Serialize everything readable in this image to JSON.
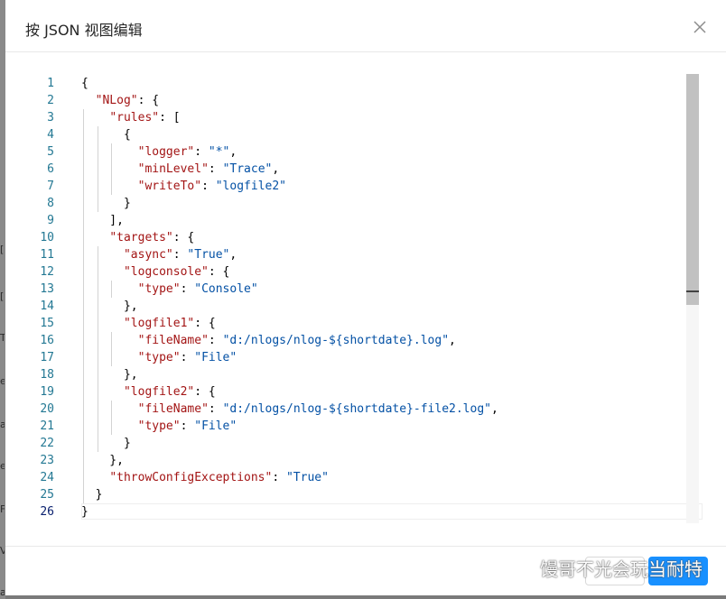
{
  "dialog": {
    "title": "按 JSON 视图编辑",
    "close_icon": "close-icon"
  },
  "editor": {
    "current_line": 26,
    "lines": [
      [
        {
          "t": "p",
          "v": "{"
        }
      ],
      [
        {
          "t": "p",
          "v": "  "
        },
        {
          "t": "k",
          "v": "\"NLog\""
        },
        {
          "t": "p",
          "v": ": {"
        }
      ],
      [
        {
          "t": "p",
          "v": "    "
        },
        {
          "t": "k",
          "v": "\"rules\""
        },
        {
          "t": "p",
          "v": ": ["
        }
      ],
      [
        {
          "t": "p",
          "v": "      {"
        }
      ],
      [
        {
          "t": "p",
          "v": "        "
        },
        {
          "t": "k",
          "v": "\"logger\""
        },
        {
          "t": "p",
          "v": ": "
        },
        {
          "t": "s",
          "v": "\"*\""
        },
        {
          "t": "p",
          "v": ","
        }
      ],
      [
        {
          "t": "p",
          "v": "        "
        },
        {
          "t": "k",
          "v": "\"minLevel\""
        },
        {
          "t": "p",
          "v": ": "
        },
        {
          "t": "s",
          "v": "\"Trace\""
        },
        {
          "t": "p",
          "v": ","
        }
      ],
      [
        {
          "t": "p",
          "v": "        "
        },
        {
          "t": "k",
          "v": "\"writeTo\""
        },
        {
          "t": "p",
          "v": ": "
        },
        {
          "t": "s",
          "v": "\"logfile2\""
        }
      ],
      [
        {
          "t": "p",
          "v": "      }"
        }
      ],
      [
        {
          "t": "p",
          "v": "    ],"
        }
      ],
      [
        {
          "t": "p",
          "v": "    "
        },
        {
          "t": "k",
          "v": "\"targets\""
        },
        {
          "t": "p",
          "v": ": {"
        }
      ],
      [
        {
          "t": "p",
          "v": "      "
        },
        {
          "t": "k",
          "v": "\"async\""
        },
        {
          "t": "p",
          "v": ": "
        },
        {
          "t": "s",
          "v": "\"True\""
        },
        {
          "t": "p",
          "v": ","
        }
      ],
      [
        {
          "t": "p",
          "v": "      "
        },
        {
          "t": "k",
          "v": "\"logconsole\""
        },
        {
          "t": "p",
          "v": ": {"
        }
      ],
      [
        {
          "t": "p",
          "v": "        "
        },
        {
          "t": "k",
          "v": "\"type\""
        },
        {
          "t": "p",
          "v": ": "
        },
        {
          "t": "s",
          "v": "\"Console\""
        }
      ],
      [
        {
          "t": "p",
          "v": "      },"
        }
      ],
      [
        {
          "t": "p",
          "v": "      "
        },
        {
          "t": "k",
          "v": "\"logfile1\""
        },
        {
          "t": "p",
          "v": ": {"
        }
      ],
      [
        {
          "t": "p",
          "v": "        "
        },
        {
          "t": "k",
          "v": "\"fileName\""
        },
        {
          "t": "p",
          "v": ": "
        },
        {
          "t": "s",
          "v": "\"d:/nlogs/nlog-${shortdate}.log\""
        },
        {
          "t": "p",
          "v": ","
        }
      ],
      [
        {
          "t": "p",
          "v": "        "
        },
        {
          "t": "k",
          "v": "\"type\""
        },
        {
          "t": "p",
          "v": ": "
        },
        {
          "t": "s",
          "v": "\"File\""
        }
      ],
      [
        {
          "t": "p",
          "v": "      },"
        }
      ],
      [
        {
          "t": "p",
          "v": "      "
        },
        {
          "t": "k",
          "v": "\"logfile2\""
        },
        {
          "t": "p",
          "v": ": {"
        }
      ],
      [
        {
          "t": "p",
          "v": "        "
        },
        {
          "t": "k",
          "v": "\"fileName\""
        },
        {
          "t": "p",
          "v": ": "
        },
        {
          "t": "s",
          "v": "\"d:/nlogs/nlog-${shortdate}-file2.log\""
        },
        {
          "t": "p",
          "v": ","
        }
      ],
      [
        {
          "t": "p",
          "v": "        "
        },
        {
          "t": "k",
          "v": "\"type\""
        },
        {
          "t": "p",
          "v": ": "
        },
        {
          "t": "s",
          "v": "\"File\""
        }
      ],
      [
        {
          "t": "p",
          "v": "      }"
        }
      ],
      [
        {
          "t": "p",
          "v": "    },"
        }
      ],
      [
        {
          "t": "p",
          "v": "    "
        },
        {
          "t": "k",
          "v": "\"throwConfigExceptions\""
        },
        {
          "t": "p",
          "v": ": "
        },
        {
          "t": "s",
          "v": "\"True\""
        }
      ],
      [
        {
          "t": "p",
          "v": "  }"
        }
      ],
      [
        {
          "t": "p",
          "v": "}"
        }
      ]
    ]
  },
  "footer": {
    "cancel_label": "",
    "ok_label": ""
  },
  "watermark": {
    "text": "馒哥不光会玩当耐特",
    "icon": "wechat-icon"
  },
  "background": {
    "marks": [
      "[",
      "[",
      "T",
      "e",
      "a",
      "e",
      "F",
      "V",
      "a"
    ]
  },
  "colors": {
    "key": "#a31515",
    "string": "#0451a5",
    "line_number": "#237893",
    "primary": "#1890ff"
  }
}
